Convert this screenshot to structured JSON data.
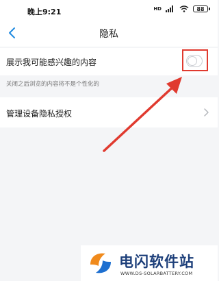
{
  "status_bar": {
    "time": "晚上9:21",
    "signal_label": "HD",
    "battery": "88"
  },
  "nav": {
    "title": "隐私",
    "back_icon": "chevron-left-icon"
  },
  "settings": {
    "interest_label": "展示我可能感兴趣的内容",
    "interest_enabled": false,
    "interest_hint": "关闭之后浏览的内容将不是个性化的",
    "device_label": "管理设备隐私授权",
    "device_chevron": "chevron-right-icon"
  },
  "annotation": {
    "color": "#e03a2f"
  },
  "watermark": {
    "name": "电闪软件站",
    "url": "WWW.DS-SOLARBATTERY.COM"
  },
  "colors": {
    "accent": "#1f8ae0",
    "annotation_red": "#e03a2f",
    "watermark_blue": "#1d3f7a",
    "watermark_orange": "#f08a1c"
  }
}
